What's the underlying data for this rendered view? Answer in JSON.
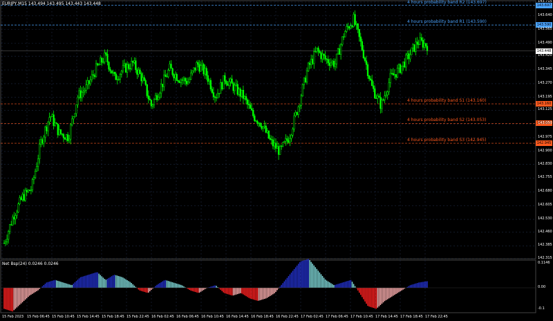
{
  "header": {
    "symbol_label": "EURJPY,M15  143.494 143.495 143.443 143.448"
  },
  "bands": [
    {
      "label": "4 hours probability band R2 (143.697)",
      "value": 143.697,
      "color": "#4aa3ff",
      "price_tag": "143.697"
    },
    {
      "label": "4 hours probability band R1 (143.590)",
      "value": 143.59,
      "color": "#4aa3ff",
      "price_tag": "143.590"
    },
    {
      "label": "4 hours probability band S1 (143.160)",
      "value": 143.16,
      "color": "#ff5a1f",
      "price_tag": "143.160"
    },
    {
      "label": "4 hours probability band S2 (143.053)",
      "value": 143.053,
      "color": "#ff5a1f",
      "price_tag": "143.053"
    },
    {
      "label": "4 hours probability band S3 (142.945)",
      "value": 142.945,
      "color": "#ff5a1f",
      "price_tag": "142.945"
    }
  ],
  "current_price": {
    "value": 143.448,
    "label": "143.448"
  },
  "y_axis": {
    "ticks": [
      "143.715",
      "143.640",
      "143.565",
      "143.490",
      "143.420",
      "143.345",
      "143.270",
      "143.195",
      "143.125",
      "143.050",
      "142.975",
      "142.900",
      "142.830",
      "142.755",
      "142.680",
      "142.605",
      "142.530",
      "142.460",
      "142.385",
      "142.315"
    ]
  },
  "x_axis": {
    "ticks": [
      "15 Feb 2023",
      "15 Feb 06:45",
      "15 Feb 10:45",
      "15 Feb 14:45",
      "15 Feb 18:45",
      "15 Feb 22:45",
      "16 Feb 02:45",
      "16 Feb 06:45",
      "16 Feb 10:45",
      "16 Feb 14:45",
      "16 Feb 18:45",
      "16 Feb 22:45",
      "17 Feb 02:45",
      "17 Feb 06:45",
      "17 Feb 10:45",
      "17 Feb 14:45",
      "17 Feb 18:45",
      "17 Feb 22:45"
    ]
  },
  "indicator": {
    "title": "Net Bsp(24) 0.0246 0.0246",
    "ticks": [
      "0.1146",
      "0.00",
      "-0.1"
    ]
  },
  "colors": {
    "candles": "#00ff00",
    "grid": "#1e2a44",
    "bull_hist": "#2230c8",
    "bull_hist_light": "#7fd8d8",
    "bear_hist": "#ff2020",
    "bear_hist_light": "#ffb0b0"
  },
  "chart_data": {
    "type": "candlestick",
    "ylim": [
      142.315,
      143.715
    ],
    "approx_close_path": [
      142.4,
      142.55,
      142.65,
      142.7,
      142.95,
      143.1,
      143.0,
      142.98,
      143.2,
      143.25,
      143.35,
      143.42,
      143.3,
      143.35,
      143.38,
      143.3,
      143.15,
      143.25,
      143.35,
      143.3,
      143.28,
      143.38,
      143.32,
      143.2,
      143.3,
      143.25,
      143.2,
      143.1,
      143.05,
      142.95,
      142.9,
      142.98,
      143.15,
      143.35,
      143.45,
      143.4,
      143.38,
      143.55,
      143.62,
      143.45,
      143.25,
      143.15,
      143.3,
      143.35,
      143.42,
      143.5,
      143.48
    ]
  }
}
